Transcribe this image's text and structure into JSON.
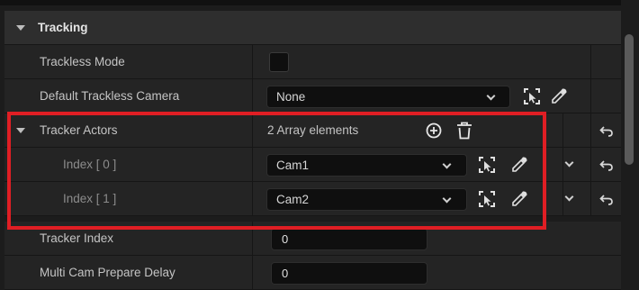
{
  "section": {
    "title": "Tracking"
  },
  "rows": {
    "trackless_mode": {
      "label": "Trackless Mode"
    },
    "default_trackless_camera": {
      "label": "Default Trackless Camera",
      "value": "None"
    },
    "tracker_actors": {
      "label": "Tracker Actors",
      "summary": "2 Array elements"
    },
    "index0": {
      "label": "Index [ 0 ]",
      "value": "Cam1"
    },
    "index1": {
      "label": "Index [ 1 ]",
      "value": "Cam2"
    },
    "tracker_index": {
      "label": "Tracker Index",
      "value": "0"
    },
    "multi_cam_prepare_delay": {
      "label": "Multi Cam Prepare Delay",
      "value": "0"
    }
  },
  "icons": {
    "expand": "triangle-down-icon",
    "browse": "select-actor-icon",
    "pick": "eyedropper-icon",
    "add": "add-element-icon",
    "clear": "trash-icon",
    "reset": "reset-arrow-icon",
    "options": "chevron-down-icon"
  },
  "colors": {
    "highlight": "#e01e24",
    "header_bg": "#2e2e2e",
    "row_bg": "#242424",
    "input_bg": "#0f0f0f"
  }
}
